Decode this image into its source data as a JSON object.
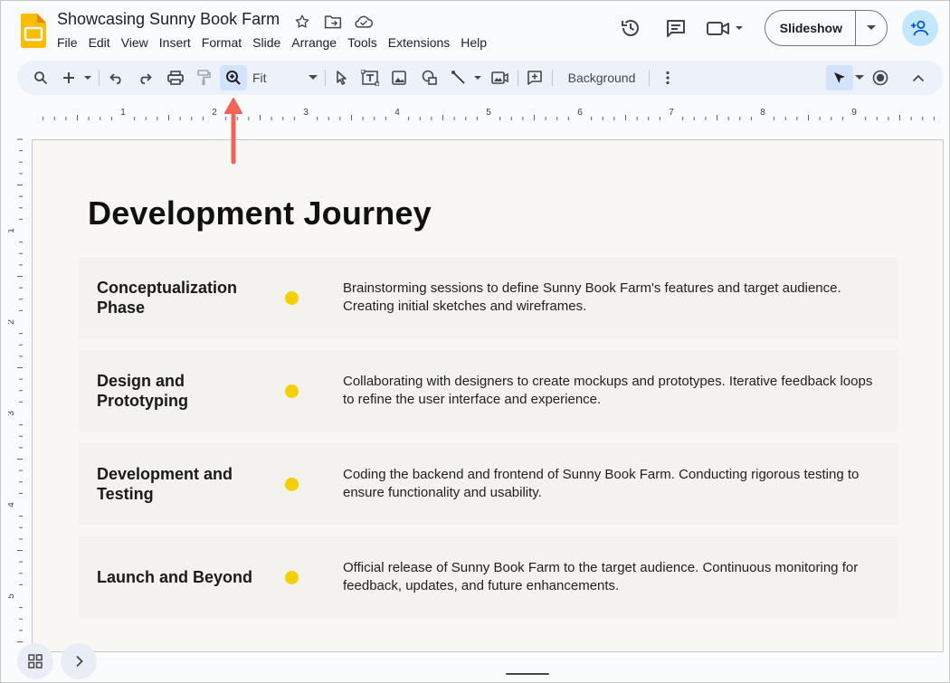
{
  "app": {
    "doc_title": "Showcasing Sunny Book Farm",
    "menu": [
      "File",
      "Edit",
      "View",
      "Insert",
      "Format",
      "Slide",
      "Arrange",
      "Tools",
      "Extensions",
      "Help"
    ],
    "slideshow_label": "Slideshow"
  },
  "toolbar": {
    "zoom_value": "Fit",
    "background_label": "Background"
  },
  "ruler": {
    "top_numbers": [
      "1",
      "2",
      "3",
      "4",
      "5",
      "6",
      "7",
      "8",
      "9"
    ],
    "left_numbers": [
      "1",
      "2",
      "3",
      "4",
      "5"
    ]
  },
  "slide": {
    "title": "Development Journey",
    "phases": [
      {
        "name": "Conceptualization Phase",
        "description": "Brainstorming sessions to define Sunny Book Farm's features and target audience. Creating initial sketches and wireframes."
      },
      {
        "name": "Design and Prototyping",
        "description": "Collaborating with designers to create mockups and prototypes. Iterative feedback loops to refine the user interface and experience."
      },
      {
        "name": "Development and Testing",
        "description": "Coding the backend and frontend of Sunny Book Farm. Conducting rigorous testing to ensure functionality and usability."
      },
      {
        "name": "Launch and Beyond",
        "description": "Official release of Sunny Book Farm to the target audience. Continuous monitoring for feedback, updates, and future enhancements."
      }
    ]
  },
  "colors": {
    "accent_dot": "#f5d000",
    "annotation_arrow": "#f0645a",
    "toolbar_bg": "#edf2fa",
    "active_bg": "#d3e3fd",
    "share_bg": "#c2e7ff"
  }
}
